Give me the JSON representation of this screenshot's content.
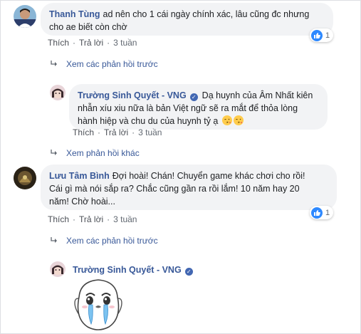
{
  "comments": [
    {
      "author": "Thanh Tùng",
      "line1": "ad nên cho 1 cái ngày chính xác, lâu cũng đc nhưng",
      "line2": "cho ae biết còn chờ",
      "like_label": "Thích",
      "reply_label": "Trả lời",
      "time": "3 tuần",
      "reaction_count": "1",
      "reply_toggle": "Xem các phản hồi trước"
    },
    {
      "author": "Trường Sinh Quyết - VNG",
      "line1": "Dạ huynh của Âm Nhất kiên",
      "line2": "nhẫn xíu xiu nữa là bản Việt ngữ sẽ ra mắt để thỏa lòng",
      "line3": "hành hiệp và chu du của huynh tỷ ạ",
      "like_label": "Thích",
      "reply_label": "Trả lời",
      "time": "3 tuần",
      "reply_toggle": "Xem phản hồi khác"
    },
    {
      "author": "Lưu Tâm Bình",
      "line1": "Đợi hoài! Chán! Chuyển game khác chơi cho rồi!",
      "line2": "Cái gì mà nói sắp ra? Chắc cũng gần ra rồi lắm! 10 năm hay 20",
      "line3": "năm! Chờ hoài...",
      "like_label": "Thích",
      "reply_label": "Trả lời",
      "time": "3 tuần",
      "reaction_count": "1",
      "reply_toggle": "Xem các phản hồi trước"
    },
    {
      "author": "Trường Sinh Quyết - VNG"
    }
  ],
  "colors": {
    "link": "#385898",
    "bubble": "#f2f3f5",
    "like": "#2e89ff"
  }
}
